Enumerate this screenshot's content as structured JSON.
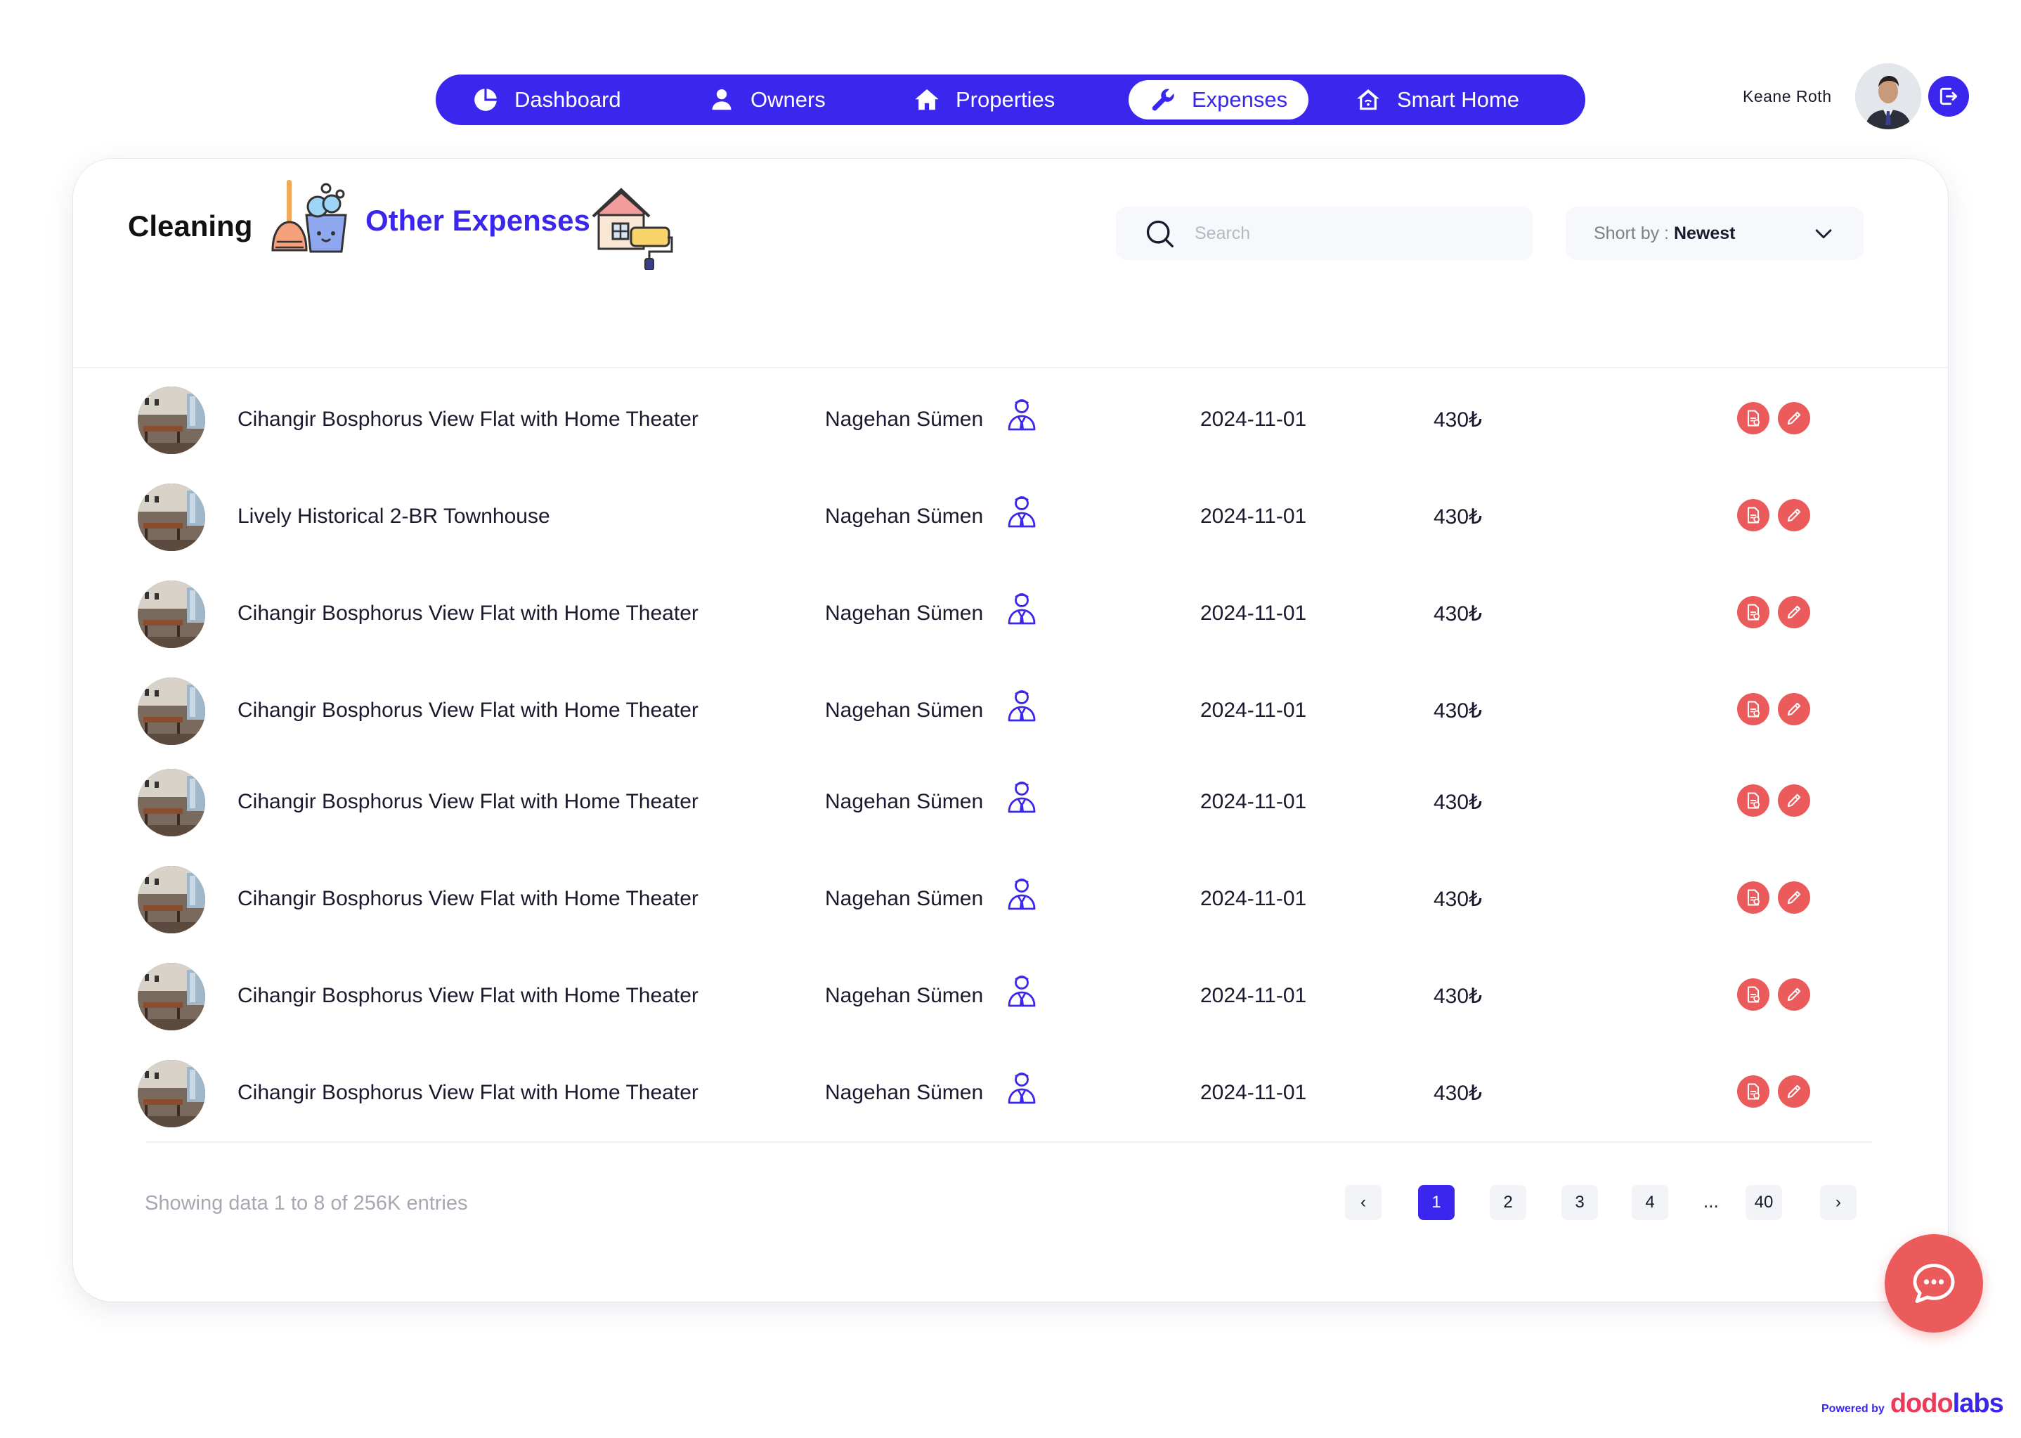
{
  "nav": {
    "items": [
      {
        "label": "Dashboard",
        "icon": "pie-chart-icon",
        "active": false
      },
      {
        "label": "Owners",
        "icon": "person-icon",
        "active": false
      },
      {
        "label": "Properties",
        "icon": "home-icon",
        "active": false
      },
      {
        "label": "Expenses",
        "icon": "wrench-icon",
        "active": true
      },
      {
        "label": "Smart Home",
        "icon": "smart-home-icon",
        "active": false
      }
    ]
  },
  "user": {
    "name": "Keane Roth"
  },
  "tabs": {
    "cleaning": "Cleaning",
    "other": "Other Expenses"
  },
  "search": {
    "placeholder": "Search",
    "value": ""
  },
  "sort": {
    "label": "Short by : ",
    "value": "Newest"
  },
  "rows": [
    {
      "property": "Cihangir Bosphorus View Flat with Home Theater",
      "owner": "Nagehan Sümen",
      "date": "2024-11-01",
      "amount": "430₺"
    },
    {
      "property": "Lively Historical 2-BR Townhouse",
      "owner": "Nagehan Sümen",
      "date": "2024-11-01",
      "amount": "430₺"
    },
    {
      "property": "Cihangir Bosphorus View Flat with Home Theater",
      "owner": "Nagehan Sümen",
      "date": "2024-11-01",
      "amount": "430₺"
    },
    {
      "property": "Cihangir Bosphorus View Flat with Home Theater",
      "owner": "Nagehan Sümen",
      "date": "2024-11-01",
      "amount": "430₺"
    },
    {
      "property": "Cihangir Bosphorus View Flat with Home Theater",
      "owner": "Nagehan Sümen",
      "date": "2024-11-01",
      "amount": "430₺"
    },
    {
      "property": "Cihangir Bosphorus View Flat with Home Theater",
      "owner": "Nagehan Sümen",
      "date": "2024-11-01",
      "amount": "430₺"
    },
    {
      "property": "Cihangir Bosphorus View Flat with Home Theater",
      "owner": "Nagehan Sümen",
      "date": "2024-11-01",
      "amount": "430₺"
    },
    {
      "property": "Cihangir Bosphorus View Flat with Home Theater",
      "owner": "Nagehan Sümen",
      "date": "2024-11-01",
      "amount": "430₺"
    }
  ],
  "pagination": {
    "summary": "Showing data 1 to 8 of  256K entries",
    "prev": "‹",
    "pages": [
      "1",
      "2",
      "3",
      "4"
    ],
    "current": "1",
    "ellipsis": "...",
    "last": "40",
    "next": "›"
  },
  "footer": {
    "powered_by": "Powered by",
    "brand_a": "dodo",
    "brand_b": "labs"
  },
  "colors": {
    "primary": "#3a26ec",
    "accent": "#eb5b5b",
    "text": "#1a1a2e",
    "muted": "#a6a8b2"
  }
}
